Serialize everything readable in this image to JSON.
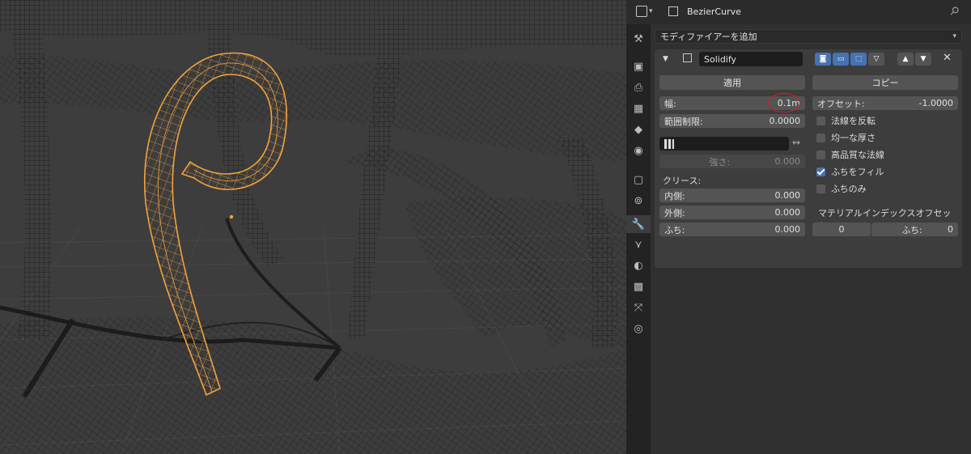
{
  "header": {
    "object_name": "BezierCurve"
  },
  "modifier_add": {
    "label": "モディファイアーを追加"
  },
  "modifier": {
    "name": "Solidify",
    "apply_label": "適用",
    "copy_label": "コピー",
    "thickness_label": "幅:",
    "thickness_value": "0.1m",
    "clamp_label": "範囲制限:",
    "clamp_value": "0.0000",
    "vertex_group_value": "",
    "strength_label": "強さ:",
    "strength_value": "0.000",
    "crease_title": "クリース:",
    "crease_inner_label": "内側:",
    "crease_inner_value": "0.000",
    "crease_outer_label": "外側:",
    "crease_outer_value": "0.000",
    "crease_rim_label": "ふち:",
    "crease_rim_value": "0.000",
    "offset_label": "オフセット:",
    "offset_value": "-1.0000",
    "checkboxes": [
      {
        "label": "法線を反転",
        "checked": false
      },
      {
        "label": "均一な厚さ",
        "checked": false
      },
      {
        "label": "高品質な法線",
        "checked": false
      },
      {
        "label": "ふちをフィル",
        "checked": true
      },
      {
        "label": "ふちのみ",
        "checked": false
      }
    ],
    "material_offset_title": "マテリアルインデックスオフセット:",
    "material_offset_value": "0",
    "material_rim_label": "ふち:",
    "material_rim_value": "0"
  },
  "colors": {
    "selection_orange": "#f5a23c",
    "accent_blue": "#4772b3",
    "annotation_red": "#d0202a"
  },
  "tabs": [
    "tool-icon",
    "render-icon",
    "output-icon",
    "view-layer-icon",
    "scene-icon",
    "world-icon",
    "object-icon",
    "constraint-icon",
    "modifier-icon",
    "particles-icon",
    "physics-icon",
    "texture-icon",
    "object-data-icon",
    "material-icon"
  ]
}
